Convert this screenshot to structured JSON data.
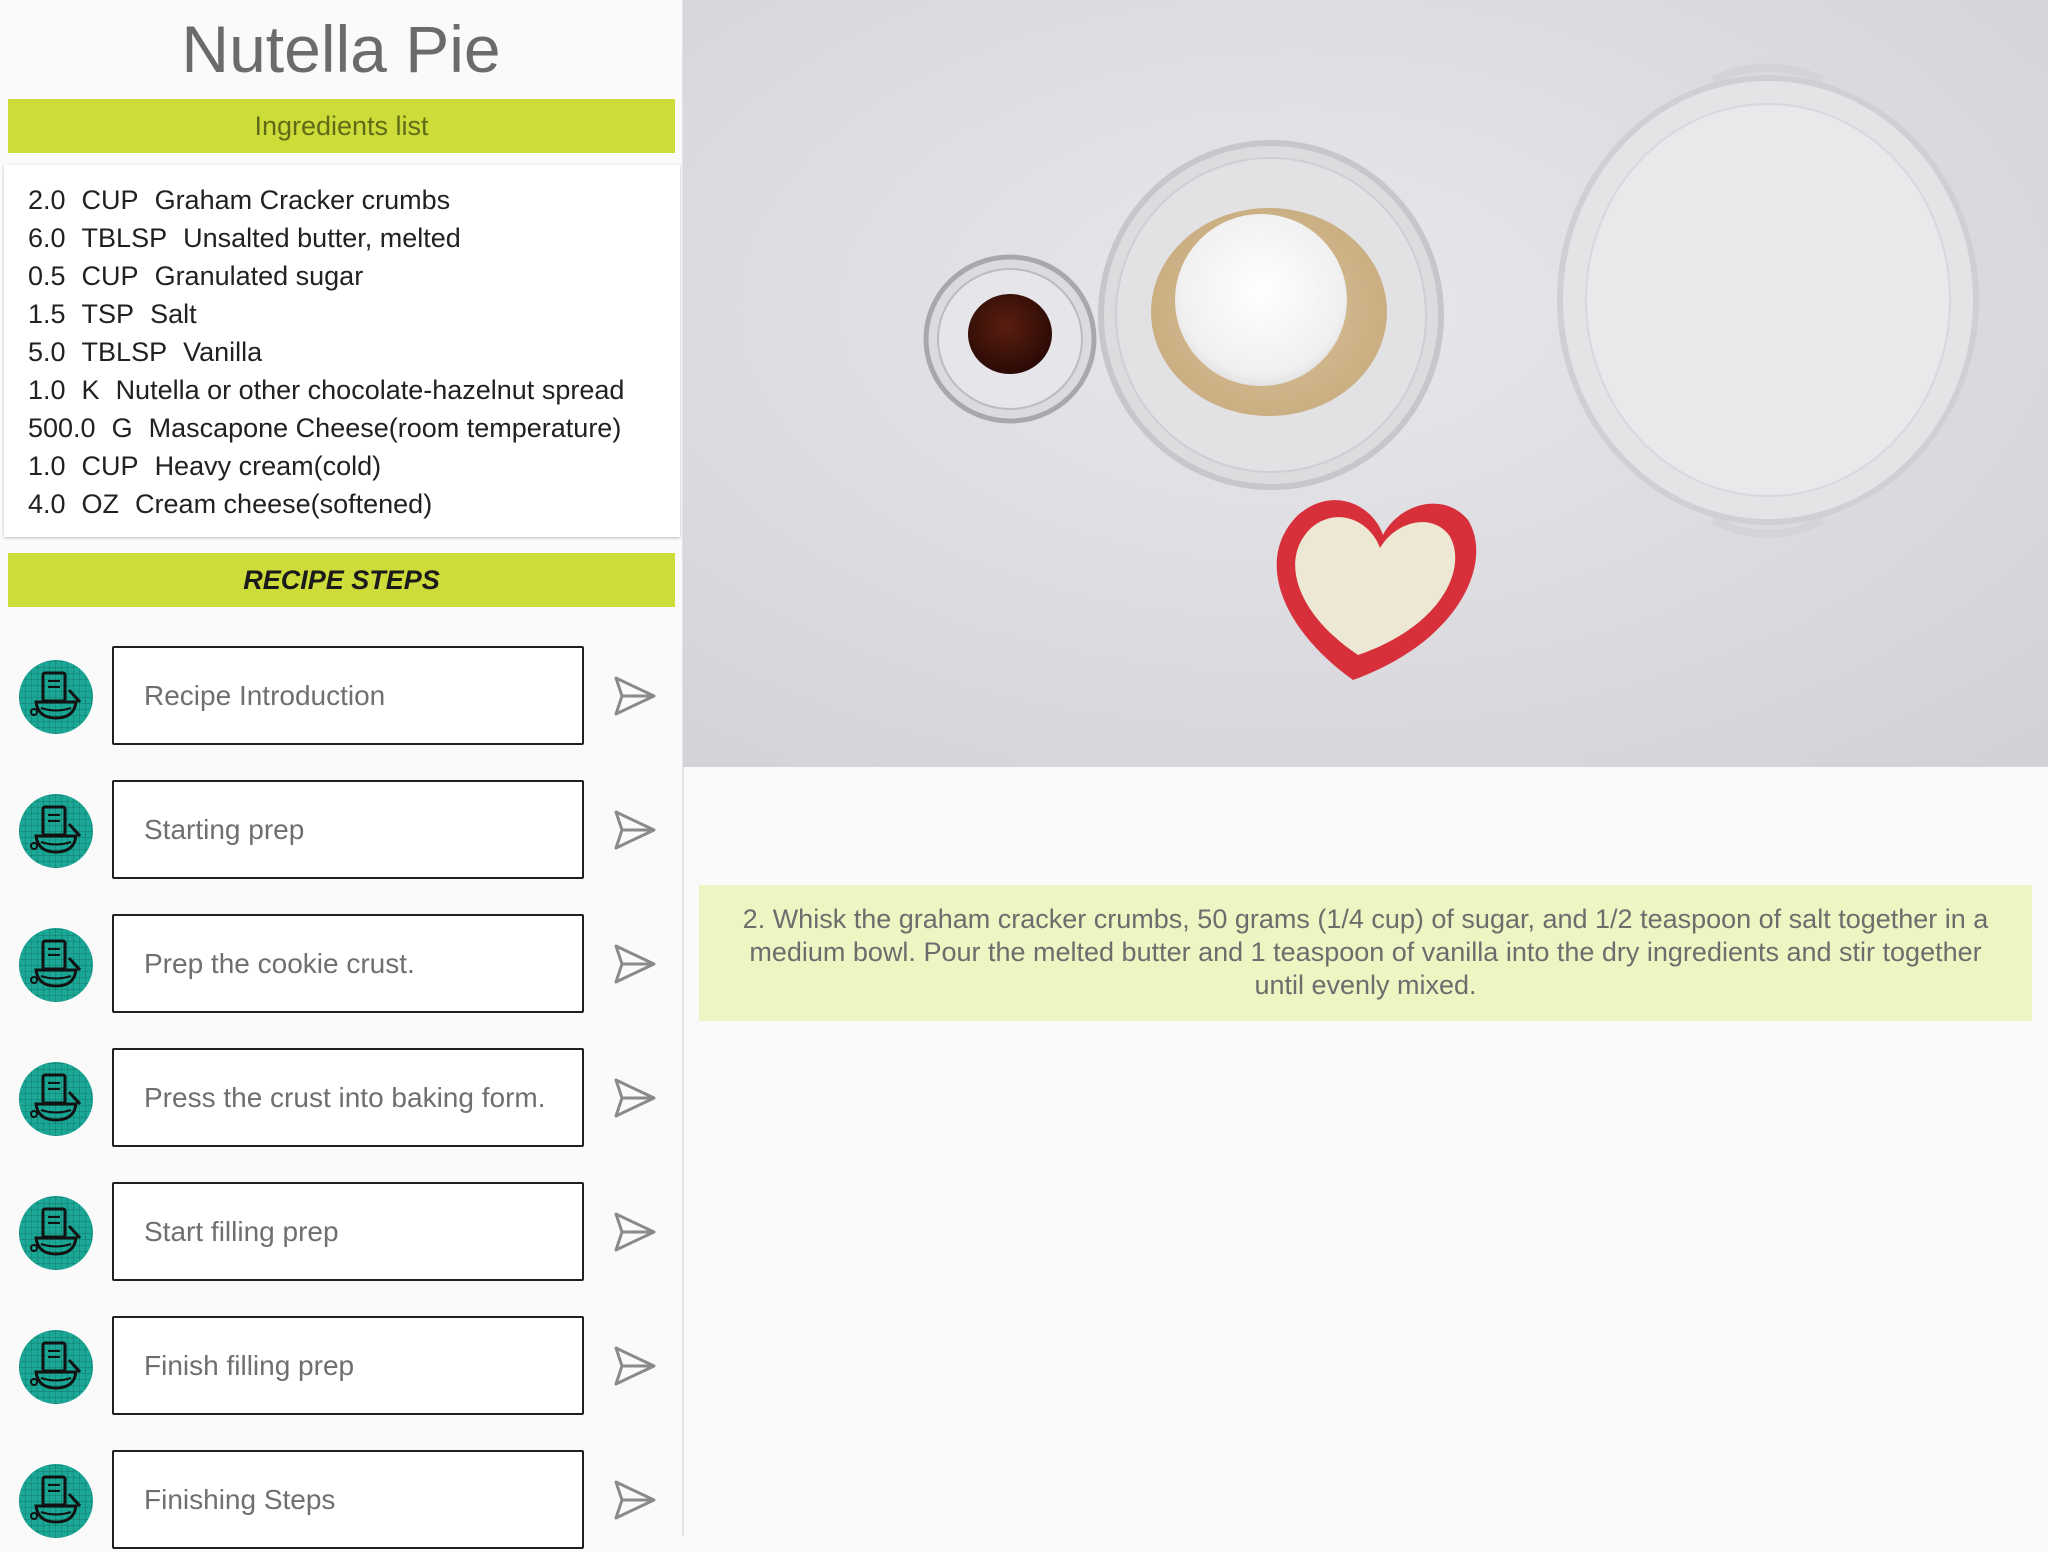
{
  "title": "Nutella Pie",
  "ingredients": {
    "header": "Ingredients list",
    "items": [
      {
        "qty": "2.0",
        "unit": "CUP",
        "name": "Graham Cracker crumbs"
      },
      {
        "qty": "6.0",
        "unit": "TBLSP",
        "name": "Unsalted butter, melted"
      },
      {
        "qty": "0.5",
        "unit": "CUP",
        "name": "Granulated sugar"
      },
      {
        "qty": "1.5",
        "unit": "TSP",
        "name": "Salt"
      },
      {
        "qty": "5.0",
        "unit": "TBLSP",
        "name": "Vanilla"
      },
      {
        "qty": "1.0",
        "unit": "K",
        "name": "Nutella or other chocolate-hazelnut spread"
      },
      {
        "qty": "500.0",
        "unit": "G",
        "name": "Mascapone Cheese(room temperature)"
      },
      {
        "qty": "1.0",
        "unit": "CUP",
        "name": "Heavy cream(cold)"
      },
      {
        "qty": "4.0",
        "unit": "OZ",
        "name": "Cream cheese(softened)"
      }
    ]
  },
  "steps": {
    "header": "RECIPE STEPS",
    "avatar_icon": "cooking-bowl-icon",
    "send_icon": "send-icon",
    "accent_color": "#1aa795",
    "items": [
      {
        "label": "Recipe Introduction"
      },
      {
        "label": "Starting prep"
      },
      {
        "label": "Prep the cookie crust."
      },
      {
        "label": "Press the crust into baking form."
      },
      {
        "label": "Start filling prep"
      },
      {
        "label": "Finish filling prep"
      },
      {
        "label": "Finishing Steps"
      }
    ]
  },
  "media": {
    "image_icon": "ingredients-photo"
  },
  "step_detail": {
    "text": "2. Whisk the graham cracker crumbs, 50 grams (1/4 cup) of sugar, and 1/2 teaspoon of salt together in a medium bowl. Pour the melted butter and 1 teaspoon of vanilla into the dry ingredients and stir together until evenly mixed."
  },
  "colors": {
    "section_bar": "#cddc39",
    "detail_bg": "#eef4c2",
    "background": "#fafafa"
  }
}
